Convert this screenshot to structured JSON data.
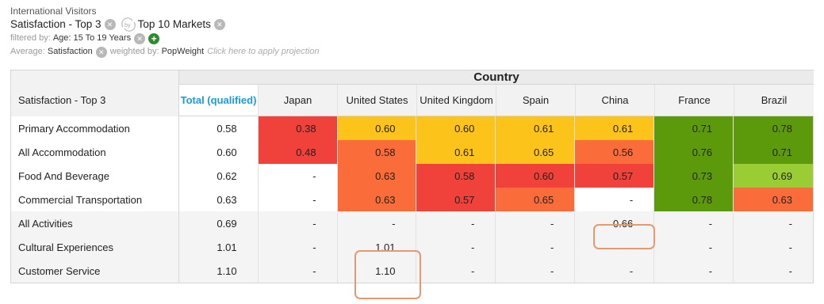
{
  "header": {
    "title": "International Visitors",
    "row_var": "Satisfaction - Top 3",
    "by_label": "by",
    "col_var": "Top 10 Markets",
    "filter_prefix": "filtered by:",
    "filter_value": "Age: 15 To 19 Years",
    "average_prefix": "Average:",
    "average_value": "Satisfaction",
    "weighted_prefix": "weighted by:",
    "weighted_value": "PopWeight",
    "projection_link": "Click here to apply projection"
  },
  "table": {
    "corner_label": "Satisfaction - Top 3",
    "group_title": "Country",
    "total_header": "Total (qualified)",
    "markets": [
      "Japan",
      "United States",
      "United Kingdom",
      "Spain",
      "China",
      "France",
      "Brazil"
    ],
    "rows": [
      {
        "label": "Primary Accommodation",
        "total": "0.58",
        "cells": [
          "0.38",
          "0.60",
          "0.60",
          "0.61",
          "0.61",
          "0.71",
          "0.78"
        ],
        "colors": [
          "rd",
          "ye",
          "ye",
          "ye",
          "ye",
          "gn",
          "gn"
        ]
      },
      {
        "label": "All Accommodation",
        "total": "0.60",
        "cells": [
          "0.48",
          "0.58",
          "0.61",
          "0.65",
          "0.56",
          "0.76",
          "0.71"
        ],
        "colors": [
          "rd",
          "or",
          "ye",
          "ye",
          "or",
          "gn",
          "gn"
        ]
      },
      {
        "label": "Food And Beverage",
        "total": "0.62",
        "cells": [
          "-",
          "0.63",
          "0.58",
          "0.60",
          "0.57",
          "0.73",
          "0.69"
        ],
        "colors": [
          "",
          "or",
          "rd",
          "rd",
          "rd",
          "gn",
          "lg"
        ]
      },
      {
        "label": "Commercial Transportation",
        "total": "0.63",
        "cells": [
          "-",
          "0.63",
          "0.57",
          "0.65",
          "-",
          "0.78",
          "0.63"
        ],
        "colors": [
          "",
          "or",
          "rd",
          "or",
          "",
          "gn",
          "or"
        ]
      },
      {
        "label": "All Activities",
        "total": "0.69",
        "cells": [
          "-",
          "-",
          "-",
          "-",
          "0.66",
          "-",
          "-"
        ],
        "colors": [
          "",
          "",
          "",
          "",
          "",
          "",
          ""
        ]
      },
      {
        "label": "Cultural Experiences",
        "total": "1.01",
        "cells": [
          "-",
          "1.01",
          "-",
          "-",
          "-",
          "-",
          "-"
        ],
        "colors": [
          "",
          "",
          "",
          "",
          "",
          "",
          ""
        ]
      },
      {
        "label": "Customer Service",
        "total": "1.10",
        "cells": [
          "-",
          "1.10",
          "-",
          "-",
          "-",
          "-",
          "-"
        ],
        "colors": [
          "",
          "",
          "",
          "",
          "",
          "",
          ""
        ]
      }
    ]
  },
  "colors": {
    "red": "#f0413a",
    "yellow": "#fcc41a",
    "orange": "#fa6c3a",
    "green": "#5c9a0c",
    "light_green": "#9acc34",
    "total_header": "#1a9bd7",
    "highlight": "#e39a72"
  }
}
